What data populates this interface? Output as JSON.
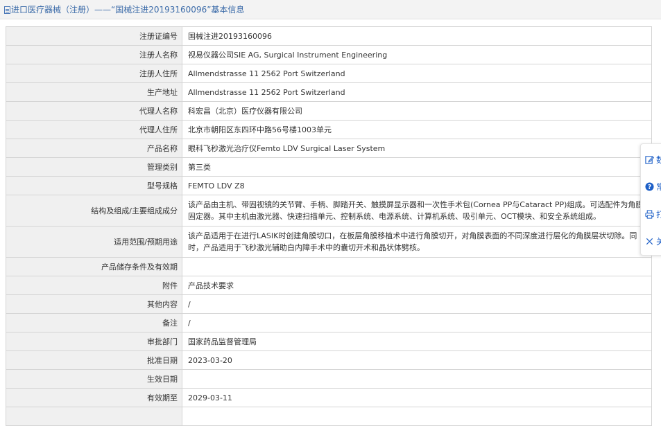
{
  "header": {
    "icon": "document-icon",
    "title": "进口医疗器械（注册）——“国械注进20193160096”基本信息"
  },
  "rows": [
    {
      "label": "注册证编号",
      "value": "国械注进20193160096"
    },
    {
      "label": "注册人名称",
      "value": "视易仪器公司SIE AG, Surgical Instrument Engineering"
    },
    {
      "label": "注册人住所",
      "value": "Allmendstrasse 11 2562 Port Switzerland"
    },
    {
      "label": "生产地址",
      "value": "Allmendstrasse 11 2562 Port Switzerland"
    },
    {
      "label": "代理人名称",
      "value": "科宏昌（北京）医疗仪器有限公司"
    },
    {
      "label": "代理人住所",
      "value": "北京市朝阳区东四环中路56号楼1003单元"
    },
    {
      "label": "产品名称",
      "value": "眼科飞秒激光治疗仪Femto LDV Surgical Laser System"
    },
    {
      "label": "管理类别",
      "value": "第三类"
    },
    {
      "label": "型号规格",
      "value": "FEMTO LDV Z8"
    },
    {
      "label": "结构及组成/主要组成成分",
      "value": "该产品由主机、带固视镜的关节臂、手柄、脚踏开关、触摸屏显示器和一次性手术包(Cornea PP与Cataract PP)组成。可选配件为角膜固定器。其中主机由激光器、快速扫描单元、控制系统、电源系统、计算机系统、吸引单元、OCT模块、和安全系统组成。"
    },
    {
      "label": "适用范围/预期用途",
      "value": "该产品适用于在进行LASIK时创建角膜切口，在板层角膜移植术中进行角膜切开，对角膜表面的不同深度进行层化的角膜层状切除。同时，产品适用于飞秒激光辅助白内障手术中的囊切开术和晶状体劈核。"
    },
    {
      "label": "产品储存条件及有效期",
      "value": ""
    },
    {
      "label": "附件",
      "value": "产品技术要求"
    },
    {
      "label": "其他内容",
      "value": "/"
    },
    {
      "label": "备注",
      "value": "/"
    },
    {
      "label": "审批部门",
      "value": "国家药品监督管理局"
    },
    {
      "label": "批准日期",
      "value": "2023-03-20"
    },
    {
      "label": "生效日期",
      "value": ""
    },
    {
      "label": "有效期至",
      "value": "2029-03-11"
    },
    {
      "label": "",
      "value": ""
    }
  ],
  "side_panel": {
    "items": [
      {
        "icon": "edit-icon",
        "label": "数"
      },
      {
        "icon": "help-icon",
        "label": "常"
      },
      {
        "icon": "print-icon",
        "label": "打"
      },
      {
        "icon": "close-icon",
        "label": "关"
      }
    ],
    "accent": "#1d5fc7"
  }
}
